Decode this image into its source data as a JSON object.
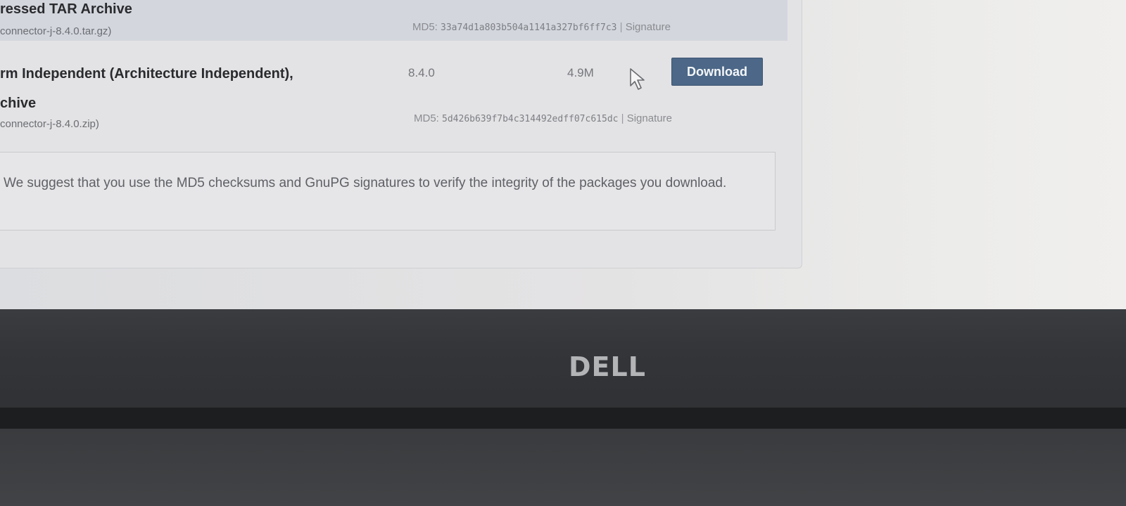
{
  "downloads": [
    {
      "title": "ressed TAR Archive",
      "filename": "connector-j-8.4.0.tar.gz)",
      "md5_label": "MD5:",
      "md5_hash": "33a74d1a803b504a1141a327bf6ff7c3",
      "separator": "|",
      "signature_label": "Signature"
    },
    {
      "title_line1": "rm Independent (Architecture Independent),",
      "title_line2": "chive",
      "version": "8.4.0",
      "size": "4.9M",
      "download_label": "Download",
      "filename": "connector-j-8.4.0.zip)",
      "md5_label": "MD5:",
      "md5_hash": "5d426b639f7b4c314492edff07c615dc",
      "separator": "|",
      "signature_label": "Signature"
    }
  ],
  "note": {
    "text": "We suggest that you use the MD5 checksums and GnuPG signatures to verify the integrity of the packages you download."
  },
  "hardware": {
    "logo_text": "DELL"
  },
  "colors": {
    "download_button": "#4c6787",
    "page_background": "#e3e3e5",
    "highlight_row": "#d3d6dd",
    "bezel": "#333539"
  },
  "icons": {
    "cursor": "mouse-pointer-icon"
  }
}
